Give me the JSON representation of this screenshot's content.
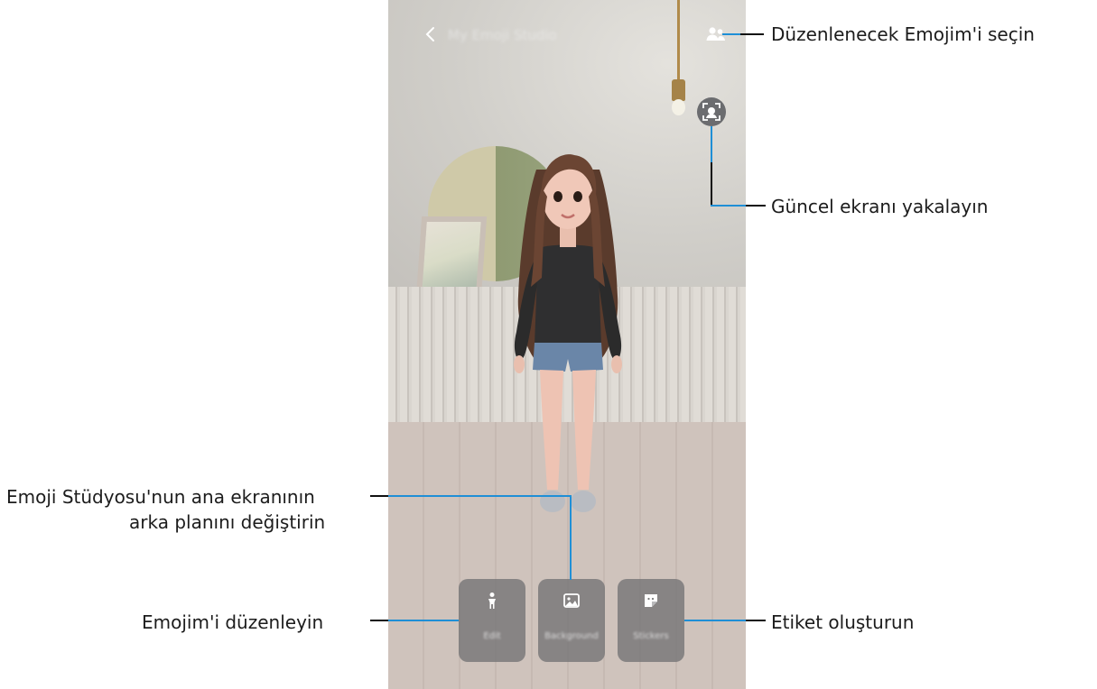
{
  "app": {
    "title": "My Emoji Studio",
    "back_icon": "chevron-left-icon",
    "switch_icon": "people-icon",
    "capture_icon": "face-capture-icon"
  },
  "toolbar": {
    "items": [
      {
        "label": "Edit",
        "icon": "person-icon"
      },
      {
        "label": "Background",
        "icon": "image-icon"
      },
      {
        "label": "Stickers",
        "icon": "sticker-icon"
      }
    ]
  },
  "callouts": {
    "select_emoji": "Düzenlenecek Emojim'i seçin",
    "capture_screen": "Güncel ekranı yakalayın",
    "change_background_line1": "Emoji Stüdyosu'nun ana ekranının",
    "change_background_line2": "arka planını değiştirin",
    "edit_emoji": "Emojim'i düzenleyin",
    "create_sticker": "Etiket oluşturun"
  },
  "colors": {
    "callout_line": "#111111",
    "callout_tip": "#1f8fd6"
  }
}
